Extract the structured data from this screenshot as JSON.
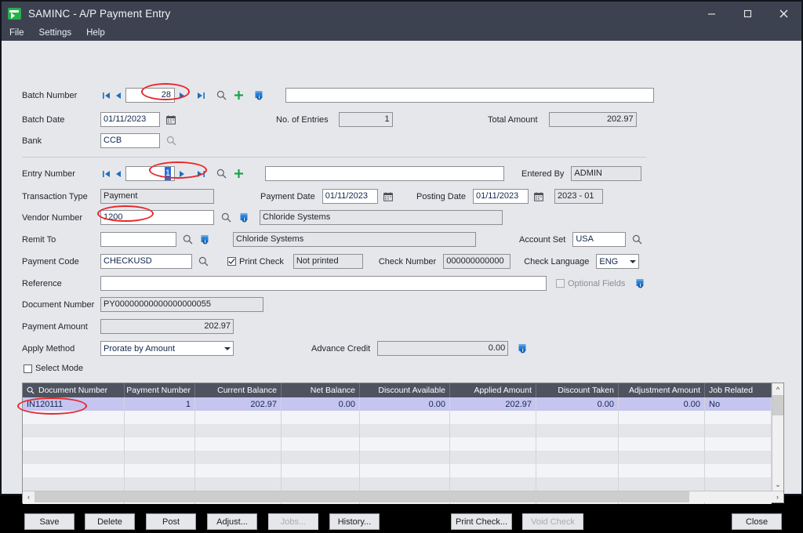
{
  "window": {
    "title": "SAMINC - A/P Payment Entry",
    "app_icon": "sage-logo-icon",
    "controls": {
      "minimize": "minimize-icon",
      "maximize": "maximize-icon",
      "close": "close-icon"
    }
  },
  "menu": {
    "items": [
      "File",
      "Settings",
      "Help"
    ]
  },
  "batch": {
    "number_label": "Batch Number",
    "number_value": "28",
    "description_value": "",
    "date_label": "Batch Date",
    "date_value": "01/11/2023",
    "bank_label": "Bank",
    "bank_value": "CCB",
    "entries_label": "No. of Entries",
    "entries_value": "1",
    "total_label": "Total Amount",
    "total_value": "202.97"
  },
  "entry": {
    "number_label": "Entry Number",
    "number_value": "1",
    "description_value": "",
    "entered_by_label": "Entered By",
    "entered_by_value": "ADMIN",
    "txn_type_label": "Transaction Type",
    "txn_type_value": "Payment",
    "payment_date_label": "Payment Date",
    "payment_date_value": "01/11/2023",
    "posting_date_label": "Posting Date",
    "posting_date_value": "01/11/2023",
    "period_value": "2023 - 01",
    "vendor_label": "Vendor Number",
    "vendor_value": "1200",
    "vendor_name": "Chloride Systems",
    "remit_label": "Remit To",
    "remit_value": "",
    "remit_name": "Chloride Systems",
    "account_set_label": "Account Set",
    "account_set_value": "USA",
    "payment_code_label": "Payment Code",
    "payment_code_value": "CHECKUSD",
    "print_check_label": "Print Check",
    "print_check_checked": true,
    "print_status_value": "Not printed",
    "check_number_label": "Check Number",
    "check_number_value": "000000000000",
    "check_language_label": "Check Language",
    "check_language_value": "ENG",
    "reference_label": "Reference",
    "reference_value": "",
    "optional_fields_label": "Optional Fields",
    "optional_fields_checked": false,
    "document_number_label": "Document Number",
    "document_number_value": "PY00000000000000000055",
    "payment_amount_label": "Payment Amount",
    "payment_amount_value": "202.97",
    "apply_method_label": "Apply Method",
    "apply_method_value": "Prorate by Amount",
    "advance_credit_label": "Advance Credit",
    "advance_credit_value": "0.00",
    "select_mode_label": "Select Mode",
    "select_mode_checked": false
  },
  "grid": {
    "columns": [
      "Document Number",
      "Payment Number",
      "Current Balance",
      "Net Balance",
      "Discount Available",
      "Applied Amount",
      "Discount Taken",
      "Adjustment Amount",
      "Job Related"
    ],
    "rows": [
      [
        "IN120111",
        "1",
        "202.97",
        "0.00",
        "0.00",
        "202.97",
        "0.00",
        "0.00",
        "No"
      ]
    ],
    "empty_row_count": 7
  },
  "buttons": {
    "save": "Save",
    "delete": "Delete",
    "post": "Post",
    "adjust": "Adjust...",
    "jobs": "Jobs...",
    "history": "History...",
    "print_check": "Print Check...",
    "void_check": "Void Check",
    "close": "Close"
  },
  "annotations": {
    "highlight_color": "#e8262a",
    "targets": [
      "batch-number-field",
      "entry-number-nav",
      "vendor-number-field",
      "grid-document-number-cell"
    ]
  }
}
